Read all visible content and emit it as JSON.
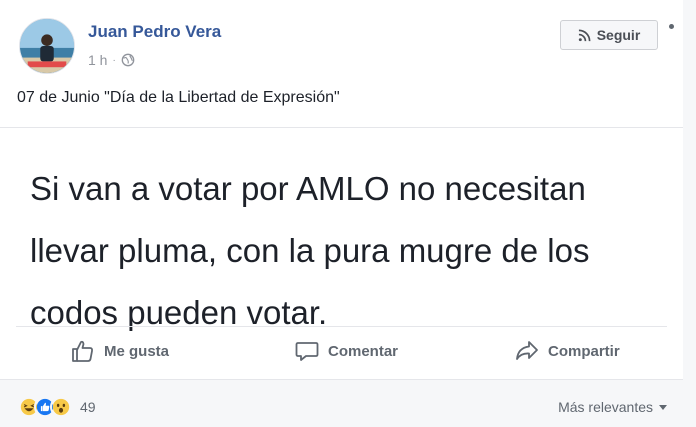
{
  "post": {
    "author": "Juan Pedro Vera",
    "time": "1 h",
    "separator": "·",
    "follow_label": "Seguir",
    "caption": "07 de Junio \"Día de la Libertad de Expresión\"",
    "image_text": "Si van a votar por AMLO no necesitan llevar pluma, con la pura mugre de los codos pueden votar."
  },
  "actions": {
    "like": "Me gusta",
    "comment": "Comentar",
    "share": "Compartir"
  },
  "footer": {
    "reaction_count": "49",
    "sort_label": "Más relevantes"
  },
  "colors": {
    "author_link": "#365899",
    "muted": "#606770",
    "like_blue": "#1877f2",
    "haha_yellow": "#f7c948"
  },
  "icons": {
    "follow": "rss-icon",
    "audience": "globe-icon",
    "like": "thumbs-up-icon",
    "comment": "speech-bubble-icon",
    "share": "share-arrow-icon",
    "reactions": [
      "haha-icon",
      "like-reaction-icon",
      "wow-icon"
    ]
  }
}
